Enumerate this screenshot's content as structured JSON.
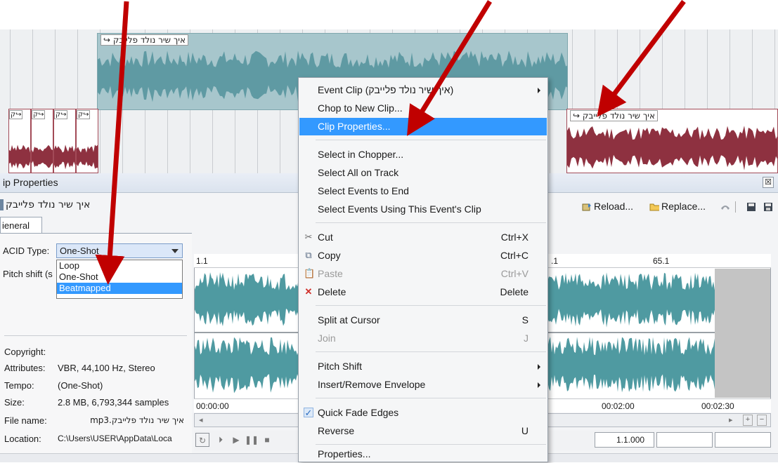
{
  "track": {
    "clip_label": "איך שיר נולד פלייבק ↪",
    "clip_label_red": "איך שיר נולד פלייבק ↪",
    "mini_labels": [
      "↪ק",
      "↪ק",
      "↪ק",
      "↪ק",
      "↪ק"
    ],
    "colors": {
      "teal": "#a7c6cc",
      "teal_wave": "#5f9aa3",
      "red_wave": "#8e3140"
    }
  },
  "clip_window": {
    "title": "ip Properties",
    "clip_name": "איך שיר נולד פלייבק",
    "close_glyph": "☒",
    "toolbar": {
      "reload_label": "Reload...",
      "replace_label": "Replace...",
      "icons": [
        "reload-icon",
        "folder-icon",
        "phone-icon",
        "save-icon",
        "save-all-icon"
      ]
    },
    "tab_label": "ieneral",
    "acid_type_label": "ACID Type:",
    "acid_type_value": "One-Shot",
    "acid_options": [
      "Loop",
      "One-Shot",
      "Beatmapped"
    ],
    "pitch_shift_label": "Pitch shift (s",
    "info": {
      "copyright_label": "Copyright:",
      "attributes_label": "Attributes:",
      "attributes_value": "VBR, 44,100 Hz, Stereo",
      "tempo_label": "Tempo:",
      "tempo_value": "(One-Shot)",
      "size_label": "Size:",
      "size_value": "2.8 MB, 6,793,344 samples",
      "filename_label": "File name:",
      "filename_value": "איך שיר נולד פלייבק.mp3",
      "location_label": "Location:",
      "location_value": "C:\\Users\\USER\\AppData\\Loca"
    },
    "ruler": {
      "left": "1.1",
      "mid": ".1",
      "right": "65.1"
    },
    "time_ruler": {
      "start": "00:00:00",
      "t1": "00:02:00",
      "t2": "00:02:30"
    },
    "position_value": "1.1.000",
    "wave_color": "#4f9aa1"
  },
  "context_menu": {
    "items": [
      {
        "label": "Event Clip (איך שיר נולד פלייבק)",
        "submenu": true
      },
      {
        "label": "Chop to New Clip..."
      },
      {
        "label": "Clip Properties...",
        "highlighted": true
      },
      {
        "label": "Select in Chopper..."
      },
      {
        "label": "Select All on Track"
      },
      {
        "label": "Select Events to End"
      },
      {
        "label": "Select Events Using This Event's Clip"
      },
      {
        "label": "Cut",
        "shortcut": "Ctrl+X",
        "icon": "scissors-icon"
      },
      {
        "label": "Copy",
        "shortcut": "Ctrl+C",
        "icon": "copy-icon"
      },
      {
        "label": "Paste",
        "shortcut": "Ctrl+V",
        "icon": "paste-icon",
        "disabled": true
      },
      {
        "label": "Delete",
        "shortcut": "Delete",
        "icon": "delete-x-icon"
      },
      {
        "label": "Split at Cursor",
        "shortcut": "S"
      },
      {
        "label": "Join",
        "shortcut": "J",
        "disabled": true
      },
      {
        "label": "Pitch Shift",
        "submenu": true
      },
      {
        "label": "Insert/Remove Envelope",
        "submenu": true
      },
      {
        "label": "Quick Fade Edges",
        "checked": true
      },
      {
        "label": "Reverse",
        "shortcut": "U"
      },
      {
        "label": "Properties..."
      }
    ]
  },
  "annotation_color": "#c00000"
}
